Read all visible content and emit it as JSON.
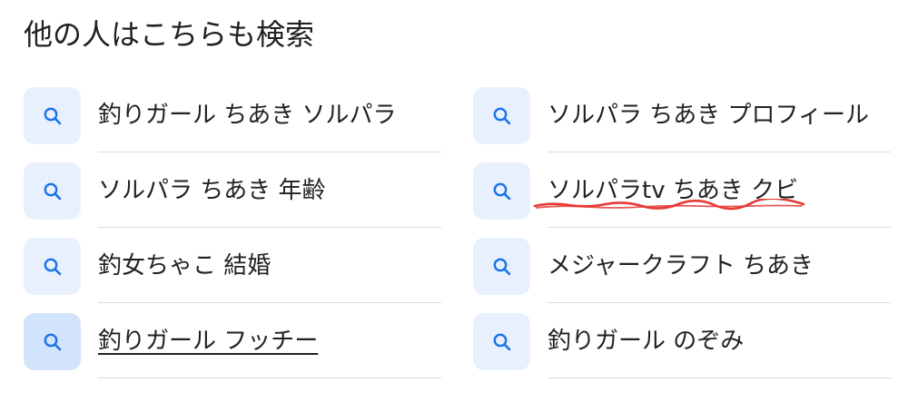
{
  "heading": "他の人はこちらも検索",
  "left_items": [
    {
      "label": "釣りガール ちあき ソルパラ",
      "icon": "search-icon"
    },
    {
      "label": "ソルパラ ちあき 年齢",
      "icon": "search-icon"
    },
    {
      "label": "釣女ちゃこ 結婚",
      "icon": "search-icon"
    },
    {
      "label": "釣りガール フッチー",
      "icon": "search-icon"
    }
  ],
  "right_items": [
    {
      "label": "ソルパラ ちあき プロフィール",
      "icon": "search-icon"
    },
    {
      "label": "ソルパラtv ちあき クビ",
      "icon": "search-icon"
    },
    {
      "label": "メジャークラフト ちあき",
      "icon": "search-icon"
    },
    {
      "label": "釣りガール のぞみ",
      "icon": "search-icon"
    }
  ],
  "colors": {
    "icon_bg": "#e8f0fe",
    "icon_bg_active": "#d2e3fc",
    "icon_stroke": "#1a73e8",
    "annotation": "#e53935"
  }
}
